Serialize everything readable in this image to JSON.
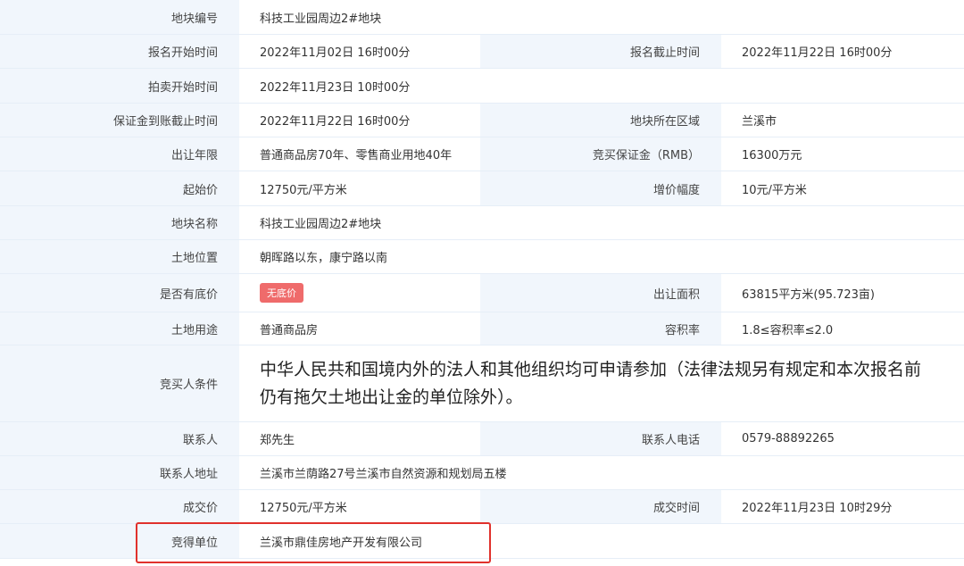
{
  "rows": [
    {
      "label": "地块编号",
      "value": "科技工业园周边2#地块"
    },
    {
      "label": "报名开始时间",
      "value": "2022年11月02日 16时00分",
      "label2": "报名截止时间",
      "value2": "2022年11月22日 16时00分"
    },
    {
      "label": "拍卖开始时间",
      "value": "2022年11月23日 10时00分"
    },
    {
      "label": "保证金到账截止时间",
      "value": "2022年11月22日 16时00分",
      "label2": "地块所在区域",
      "value2": "兰溪市"
    },
    {
      "label": "出让年限",
      "value": "普通商品房70年、零售商业用地40年",
      "label2": "竞买保证金（RMB）",
      "value2": "16300万元"
    },
    {
      "label": "起始价",
      "value": "12750元/平方米",
      "label2": "增价幅度",
      "value2": "10元/平方米"
    },
    {
      "label": "地块名称",
      "value": "科技工业园周边2#地块"
    },
    {
      "label": "土地位置",
      "value": "朝晖路以东，康宁路以南"
    },
    {
      "label": "是否有底价",
      "badge": "无底价",
      "label2": "出让面积",
      "value2": "63815平方米(95.723亩)"
    },
    {
      "label": "土地用途",
      "value": "普通商品房",
      "label2": "容积率",
      "value2": "1.8≤容积率≤2.0"
    },
    {
      "label": "竞买人条件",
      "value": "中华人民共和国境内外的法人和其他组织均可申请参加（法律法规另有规定和本次报名前仍有拖欠土地出让金的单位除外）。"
    },
    {
      "label": "联系人",
      "value": "郑先生",
      "label2": "联系人电话",
      "value2": "0579-88892265"
    },
    {
      "label": "联系人地址",
      "value": "兰溪市兰荫路27号兰溪市自然资源和规划局五楼"
    },
    {
      "label": "成交价",
      "value": "12750元/平方米",
      "label2": "成交时间",
      "value2": "2022年11月23日 10时29分"
    },
    {
      "label": "竞得单位",
      "value": "兰溪市鼎佳房地产开发有限公司"
    }
  ],
  "colors": {
    "label_bg": "#f1f6fc",
    "badge_bg": "#ef6b6b",
    "highlight_border": "#e0312c"
  }
}
